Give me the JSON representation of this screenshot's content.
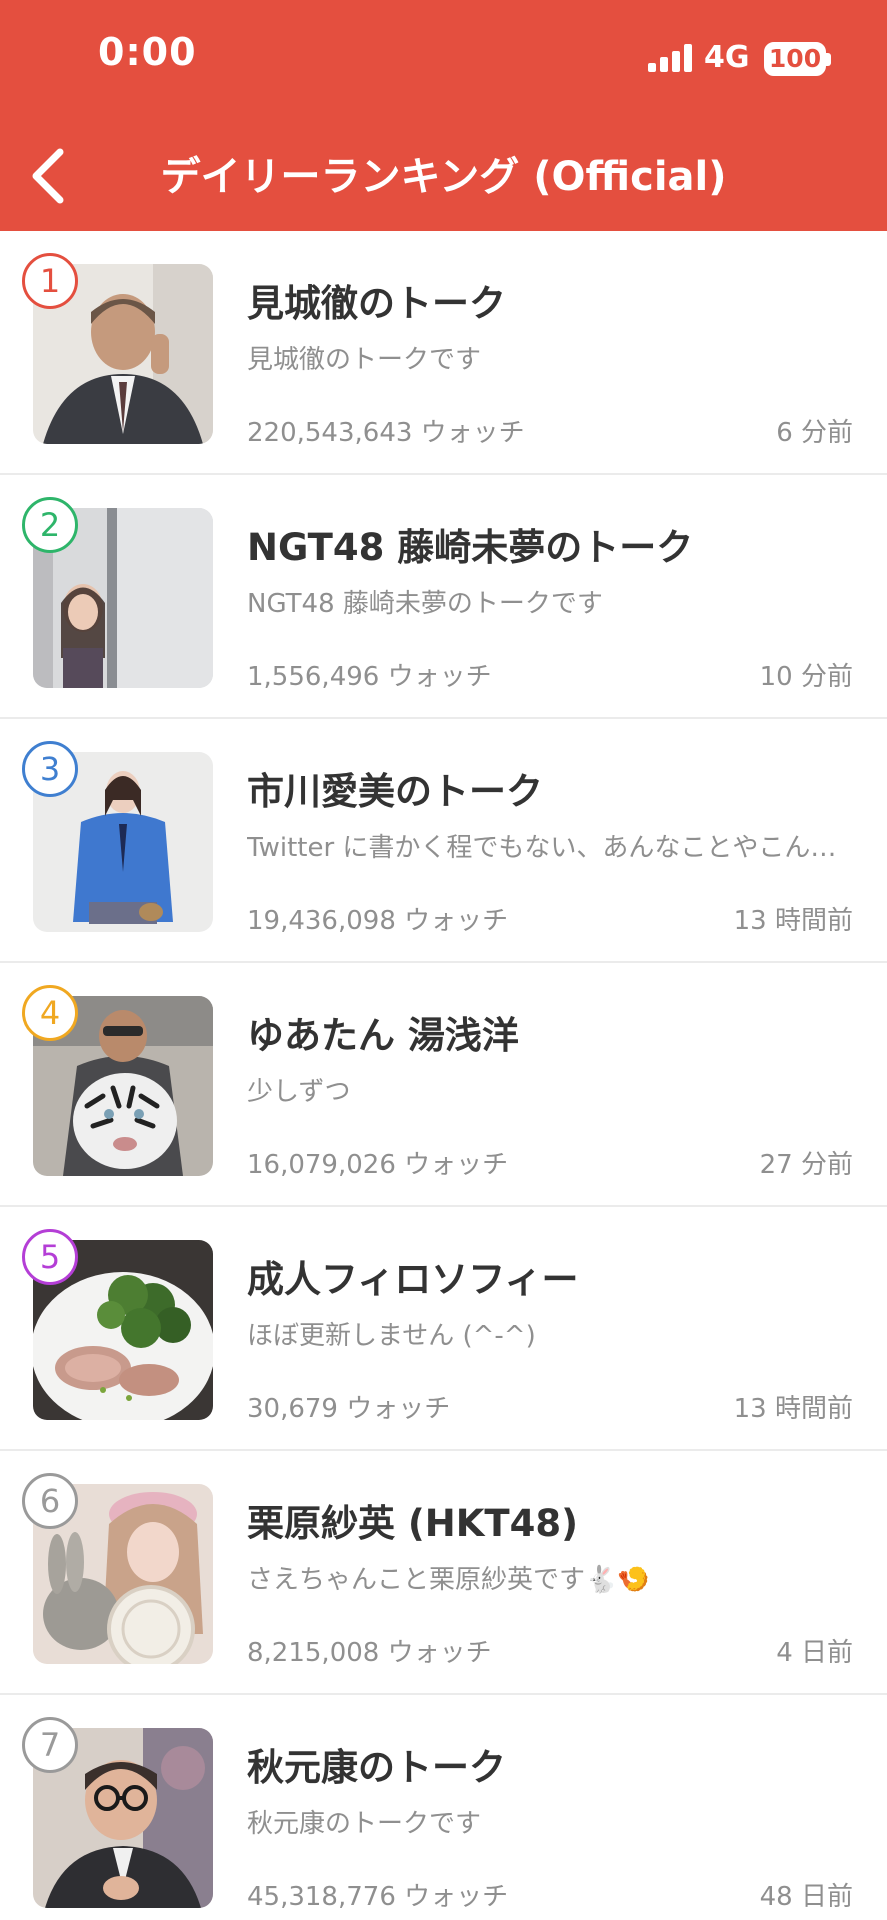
{
  "status_bar": {
    "time": "0:00",
    "network": "4G",
    "battery": "100"
  },
  "header": {
    "title": "デイリーランキング (Official)",
    "back_icon": "chevron-left-icon"
  },
  "colors": {
    "accent": "#e44f3f"
  },
  "ranking": [
    {
      "rank": "1",
      "badge_color": "#e44f3f",
      "title": "見城徹のトーク",
      "description": "見城徹のトークです",
      "watch": "220,543,643 ウォッチ",
      "time": "6 分前"
    },
    {
      "rank": "2",
      "badge_color": "#2eb56a",
      "title": "NGT48 藤崎未夢のトーク",
      "description": "NGT48 藤崎未夢のトークです",
      "watch": "1,556,496 ウォッチ",
      "time": "10 分前"
    },
    {
      "rank": "3",
      "badge_color": "#3f7fd0",
      "title": "市川愛美のトーク",
      "description": "Twitter に書かく程でもない、あんなことやこんな…",
      "watch": "19,436,098 ウォッチ",
      "time": "13 時間前"
    },
    {
      "rank": "4",
      "badge_color": "#f0a821",
      "title": "ゆあたん 湯浅洋",
      "description": "少しずつ",
      "watch": "16,079,026 ウォッチ",
      "time": "27 分前"
    },
    {
      "rank": "5",
      "badge_color": "#b43ed6",
      "title": "成人フィロソフィー",
      "description": "ほぼ更新しません (^-^)",
      "watch": "30,679 ウォッチ",
      "time": "13 時間前"
    },
    {
      "rank": "6",
      "badge_color": "#9a9a9a",
      "title": "栗原紗英 (HKT48)",
      "description": "さえちゃんこと栗原紗英です🐇🍤",
      "watch": "8,215,008 ウォッチ",
      "time": "4 日前"
    },
    {
      "rank": "7",
      "badge_color": "#9a9a9a",
      "title": "秋元康のトーク",
      "description": "秋元康のトークです",
      "watch": "45,318,776 ウォッチ",
      "time": "48 日前"
    }
  ]
}
